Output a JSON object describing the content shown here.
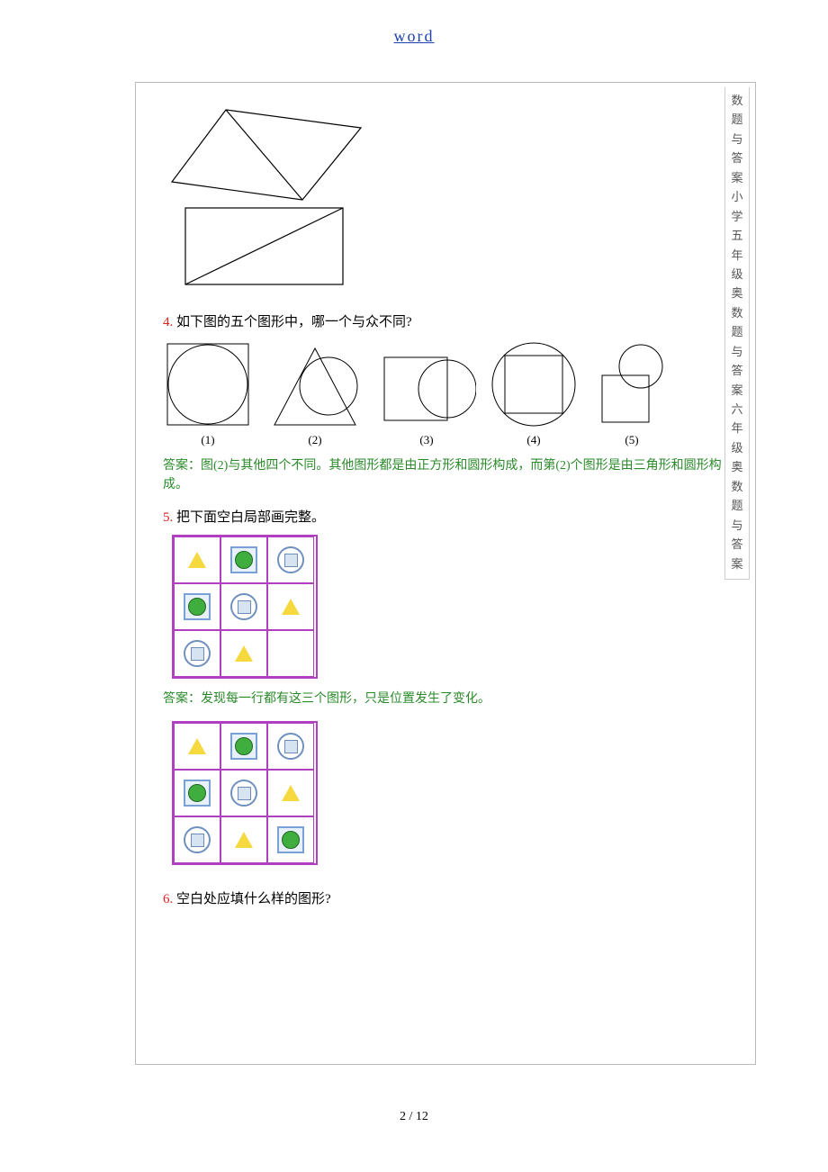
{
  "header": {
    "link_text": "word"
  },
  "sidebar_text": "数题与答案小学五年级奥数题与答案六年级奥数题与答案",
  "q4": {
    "num": "4.",
    "text": "如下图的五个图形中，哪一个与众不同?",
    "labels": [
      "(1)",
      "(2)",
      "(3)",
      "(4)",
      "(5)"
    ],
    "answer": "答案：图(2)与其他四个不同。其他图形都是由正方形和圆形构成，而第(2)个图形是由三角形和圆形构成。"
  },
  "q5": {
    "num": "5.",
    "text": "把下面空白局部画完整。",
    "answer": "答案：发现每一行都有这三个图形，只是位置发生了变化。"
  },
  "q6": {
    "num": "6.",
    "text": "空白处应填什么样的图形?"
  },
  "footer": {
    "page": "2 / 12"
  }
}
